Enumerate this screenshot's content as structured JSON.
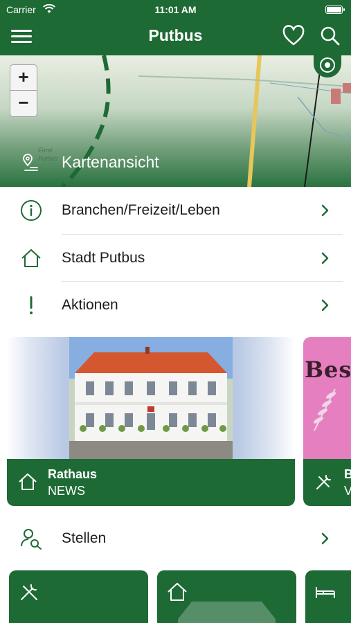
{
  "status_bar": {
    "carrier": "Carrier",
    "time": "11:01 AM"
  },
  "header": {
    "title": "Putbus"
  },
  "map": {
    "label": "Kartenansicht",
    "zoom_in": "+",
    "zoom_out": "−",
    "map_text_1": "Forst",
    "map_text_2": "Putbus"
  },
  "menu": [
    {
      "label": "Branchen/Freizeit/Leben",
      "icon": "info-icon"
    },
    {
      "label": "Stadt Putbus",
      "icon": "home-icon"
    },
    {
      "label": "Aktionen",
      "icon": "exclamation-icon"
    }
  ],
  "carousel": [
    {
      "title": "Rathaus",
      "subtitle": "NEWS",
      "icon": "home-icon"
    },
    {
      "title": "B",
      "subtitle": "V",
      "icon": "tools-icon",
      "image_text": "Bes"
    }
  ],
  "stellen": {
    "label": "Stellen",
    "icon": "person-search-icon"
  },
  "tiles": [
    {
      "icon": "tools-icon"
    },
    {
      "icon": "home-icon"
    },
    {
      "icon": "bed-icon"
    }
  ],
  "colors": {
    "brand_green": "#1e6a35",
    "text": "#1c1c1c",
    "separator": "#e1e1e1"
  }
}
